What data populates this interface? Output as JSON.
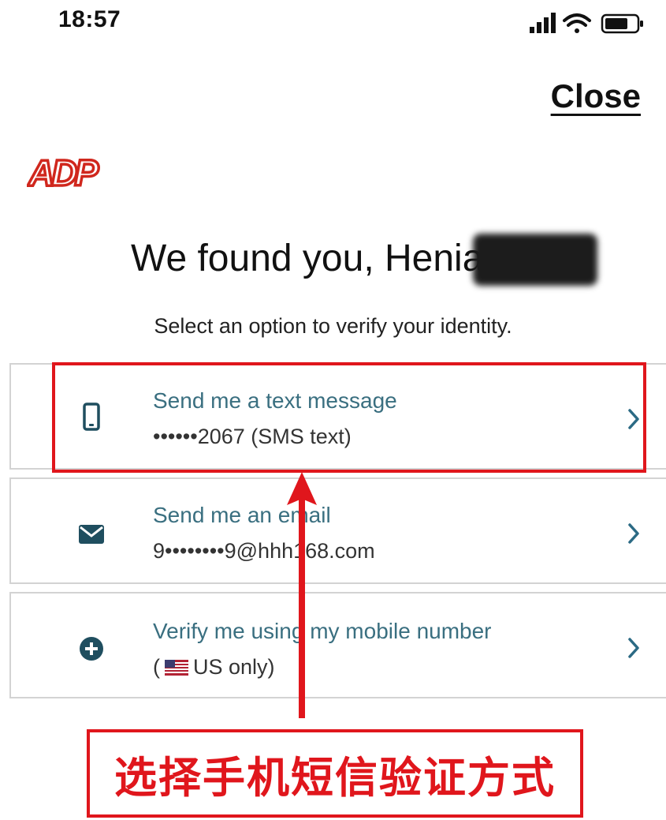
{
  "status_bar": {
    "time": "18:57",
    "icons": [
      "signal-icon",
      "wifi-icon",
      "battery-icon"
    ]
  },
  "header": {
    "close_label": "Close"
  },
  "brand": {
    "logo_text": "ADP",
    "logo_color": "#d0271d"
  },
  "main": {
    "greeting": "We found you, Henian",
    "subtitle": "Select an option to verify your identity.",
    "options": [
      {
        "icon": "mobile-phone-icon",
        "title": "Send me a text message",
        "detail": "••••••2067 (SMS text)"
      },
      {
        "icon": "envelope-icon",
        "title": "Send me an email",
        "detail": "9••••••••9@hhh168.com"
      },
      {
        "icon": "plus-circle-icon",
        "title": "Verify me using my mobile number",
        "detail_prefix": "(",
        "detail_suffix": "US only)"
      }
    ]
  },
  "annotation": {
    "caption": "选择手机短信验证方式",
    "color": "#e0161c"
  },
  "colors": {
    "option_title": "#3a6f80",
    "icon": "#1f4e5f",
    "chevron": "#2b6a84"
  }
}
